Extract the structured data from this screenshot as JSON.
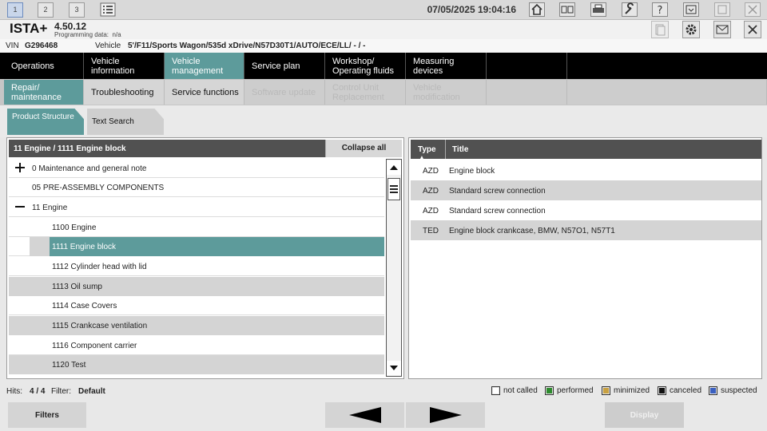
{
  "topbar": {
    "tabs": [
      "1",
      "2",
      "3"
    ],
    "datetime": "07/05/2025 19:04:16"
  },
  "app": {
    "name": "ISTA+",
    "version": "4.50.12",
    "programming_label": "Programming data:",
    "programming_value": "n/a"
  },
  "vin": {
    "vin_label": "VIN",
    "vin_value": "G296468",
    "vehicle_label": "Vehicle",
    "vehicle_value": "5'/F11/Sports Wagon/535d xDrive/N57D30T1/AUTO/ECE/LL/ - / -"
  },
  "mainnav": [
    {
      "label": "Operations"
    },
    {
      "label": "Vehicle information"
    },
    {
      "label": "Vehicle management"
    },
    {
      "label": "Service plan"
    },
    {
      "label": "Workshop/ Operating fluids"
    },
    {
      "label": "Measuring devices"
    }
  ],
  "subnav": [
    {
      "label": "Repair/ maintenance"
    },
    {
      "label": "Troubleshooting"
    },
    {
      "label": "Service functions"
    },
    {
      "label": "Software update"
    },
    {
      "label": "Control Unit Replacement"
    },
    {
      "label": "Vehicle modification"
    }
  ],
  "tabs": [
    {
      "label": "Product Structure"
    },
    {
      "label": "Text Search"
    }
  ],
  "left": {
    "header": "11 Engine / 1111 Engine block",
    "collapse_label": "Collapse all",
    "tree": [
      {
        "label": "0 Maintenance and general note"
      },
      {
        "label": "05 PRE-ASSEMBLY COMPONENTS"
      },
      {
        "label": "11 Engine"
      },
      {
        "label": "1100 Engine"
      },
      {
        "label": "1111 Engine block"
      },
      {
        "label": "1112 Cylinder head with lid"
      },
      {
        "label": "1113 Oil sump"
      },
      {
        "label": "1114 Case Covers"
      },
      {
        "label": "1115 Crankcase ventilation"
      },
      {
        "label": "1116 Component carrier"
      },
      {
        "label": "1120 Test"
      }
    ]
  },
  "right": {
    "col_type": "Type ▲",
    "col_title": "Title",
    "rows": [
      {
        "type": "AZD",
        "title": "Engine block"
      },
      {
        "type": "AZD",
        "title": "Standard screw connection"
      },
      {
        "type": "AZD",
        "title": "Standard screw connection"
      },
      {
        "type": "TED",
        "title": "Engine block crankcase, BMW, N57O1, N57T1"
      }
    ]
  },
  "status": {
    "hits_label": "Hits:",
    "hits_value": "4 / 4",
    "filter_label": "Filter:",
    "filter_value": "Default",
    "legend": [
      {
        "label": "not called",
        "color": "#ffffff"
      },
      {
        "label": "performed",
        "color": "#2e8b2e"
      },
      {
        "label": "minimized",
        "color": "#c8a040"
      },
      {
        "label": "canceled",
        "color": "#111111"
      },
      {
        "label": "suspected",
        "color": "#3a5fc0"
      }
    ]
  },
  "buttons": {
    "filters": "Filters",
    "display": "Display"
  },
  "colors": {
    "accent": "#5d9b9b",
    "nav_bg": "#000000",
    "header_bg": "#515151"
  }
}
